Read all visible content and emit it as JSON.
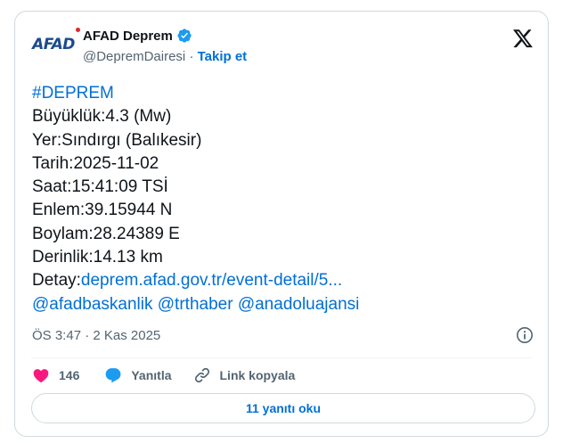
{
  "tweet": {
    "author_name": "AFAD Deprem",
    "handle": "@DepremDairesi",
    "separator": "·",
    "follow_label": "Takip et",
    "avatar_text": "AFAD",
    "lines": {
      "hashtag": "#DEPREM",
      "magnitude": "Büyüklük:4.3 (Mw)",
      "location": "Yer:Sındırgı (Balıkesir)",
      "date": "Tarih:2025-11-02",
      "time": "Saat:15:41:09 TSİ",
      "latitude": "Enlem:39.15944 N",
      "longitude": "Boylam:28.24389 E",
      "depth": "Derinlik:14.13 km",
      "detail_prefix": "Detay:",
      "detail_link": "deprem.afad.gov.tr/event-detail/5..."
    },
    "mentions": [
      "@afadbaskanlik",
      "@trthaber",
      "@anadoluajansi"
    ],
    "timestamp": "ÖS 3:47 · 2 Kas 2025",
    "like_count": "146",
    "reply_label": "Yanıtla",
    "copy_link_label": "Link kopyala",
    "read_replies_label": "11 yanıtı oku"
  },
  "colors": {
    "link": "#006fd6",
    "verified": "#1d9bf0",
    "like": "#f91880",
    "border": "#cfd9de",
    "secondary_text": "#536471"
  },
  "icons": [
    "verified-badge-icon",
    "x-logo-icon",
    "info-icon",
    "heart-icon",
    "reply-bubble-icon",
    "link-icon"
  ]
}
